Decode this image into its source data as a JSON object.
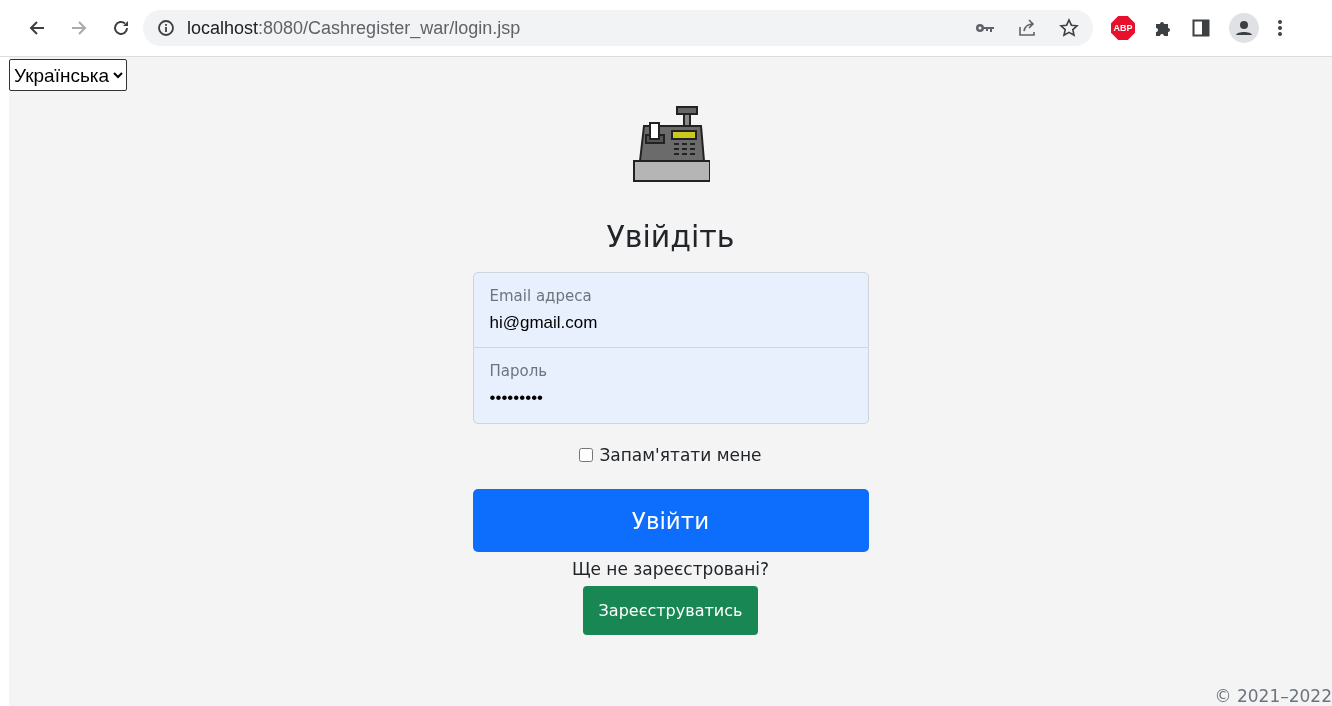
{
  "browser": {
    "url_host": "localhost",
    "url_path": ":8080/Cashregister_war/login.jsp",
    "extension_badge": "ABP"
  },
  "language_select": {
    "value": "Українська"
  },
  "heading": "Увійдіть",
  "form": {
    "fields": [
      {
        "label": "Email адреса",
        "value": "hi@gmail.com"
      },
      {
        "label": "Пароль",
        "value": "•••••••••"
      }
    ],
    "remember": {
      "label": "Запам'ятати мене",
      "checked": false
    },
    "submit": "Увійти",
    "register_prompt": "Ще не зареєстровані?",
    "register_button": "Зареєструватись"
  },
  "footer": "© 2021–2022"
}
